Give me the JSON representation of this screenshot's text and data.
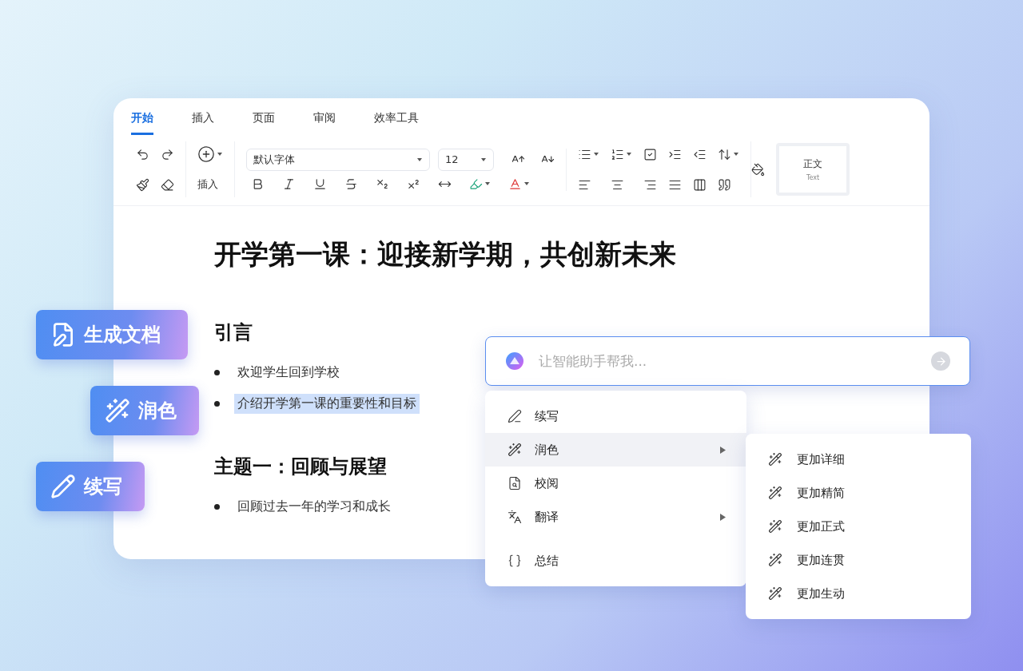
{
  "editor": {
    "tabs": [
      {
        "label": "开始",
        "selected": true
      },
      {
        "label": "插入",
        "selected": false
      },
      {
        "label": "页面",
        "selected": false
      },
      {
        "label": "审阅",
        "selected": false
      },
      {
        "label": "效率工具",
        "selected": false
      }
    ],
    "toolbar": {
      "insert_label": "插入",
      "font": {
        "value": "默认字体"
      },
      "size": {
        "value": "12"
      },
      "style": {
        "title": "正文",
        "subtitle": "Text"
      }
    },
    "document": {
      "title": "开学第一课：迎接新学期，共创新未来",
      "sections": [
        {
          "heading": "引言",
          "bullets": [
            {
              "text": "欢迎学生回到学校",
              "selected": false
            },
            {
              "text": "介绍开学第一课的重要性和目标",
              "selected": true
            }
          ]
        },
        {
          "heading": "主题一：回顾与展望",
          "bullets": [
            {
              "text": "回顾过去一年的学习和成长",
              "selected": false
            }
          ]
        }
      ]
    }
  },
  "feature_chips": [
    "生成文档",
    "润色",
    "续写"
  ],
  "assistant": {
    "placeholder": "让智能助手帮我...",
    "menu": {
      "groups": [
        [
          {
            "label": "续写",
            "selected": false,
            "has_submenu": false
          },
          {
            "label": "润色",
            "selected": true,
            "has_submenu": true
          },
          {
            "label": "校阅",
            "selected": false,
            "has_submenu": false
          },
          {
            "label": "翻译",
            "selected": false,
            "has_submenu": true
          }
        ],
        [
          {
            "label": "总结",
            "selected": false,
            "has_submenu": false
          }
        ]
      ]
    },
    "submenu": [
      "更加详细",
      "更加精简",
      "更加正式",
      "更加连贯",
      "更加生动"
    ]
  }
}
